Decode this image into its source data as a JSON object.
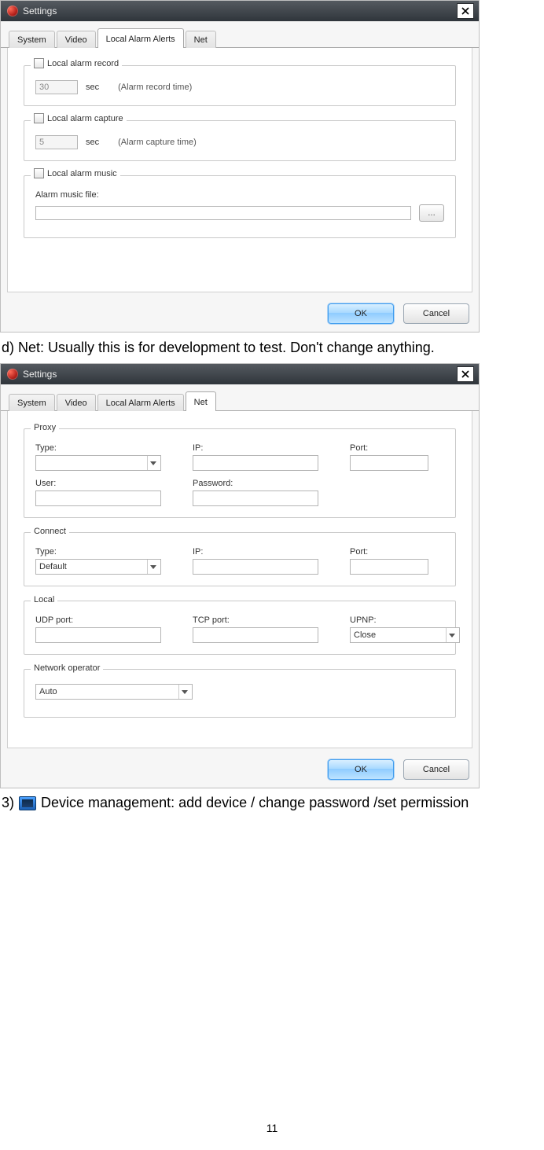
{
  "doc": {
    "line_d": "d) Net: Usually this is for development to test. Don't change anything.",
    "line_3_num": "3)",
    "line_3_rest": "Device management: add device / change password /set permission",
    "page_number": "11"
  },
  "dialog1": {
    "title": "Settings",
    "tabs": [
      "System",
      "Video",
      "Local Alarm Alerts",
      "Net"
    ],
    "active_tab_index": 2,
    "group_record": {
      "legend": "Local alarm record",
      "value": "30",
      "suffix": "sec",
      "hint": "(Alarm record time)"
    },
    "group_capture": {
      "legend": "Local alarm capture",
      "value": "5",
      "suffix": "sec",
      "hint": "(Alarm capture time)"
    },
    "group_music": {
      "legend": "Local alarm music",
      "file_label": "Alarm music file:",
      "file_value": "",
      "browse_label": "…"
    },
    "ok": "OK",
    "cancel": "Cancel"
  },
  "dialog2": {
    "title": "Settings",
    "tabs": [
      "System",
      "Video",
      "Local Alarm Alerts",
      "Net"
    ],
    "active_tab_index": 3,
    "proxy": {
      "legend": "Proxy",
      "type_label": "Type:",
      "type_value": "",
      "ip_label": "IP:",
      "ip_value": "",
      "port_label": "Port:",
      "port_value": "",
      "user_label": "User:",
      "user_value": "",
      "password_label": "Password:",
      "password_value": ""
    },
    "connect": {
      "legend": "Connect",
      "type_label": "Type:",
      "type_value": "Default",
      "ip_label": "IP:",
      "ip_value": "",
      "port_label": "Port:",
      "port_value": ""
    },
    "local": {
      "legend": "Local",
      "udp_label": "UDP port:",
      "udp_value": "",
      "tcp_label": "TCP port:",
      "tcp_value": "",
      "upnp_label": "UPNP:",
      "upnp_value": "Close"
    },
    "netop": {
      "legend": "Network operator",
      "value": "Auto"
    },
    "ok": "OK",
    "cancel": "Cancel"
  }
}
